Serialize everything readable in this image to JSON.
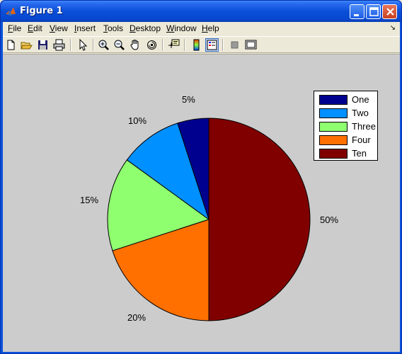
{
  "window": {
    "title": "Figure 1"
  },
  "menu": {
    "items": [
      {
        "label": "File",
        "key": "F",
        "rest": "ile"
      },
      {
        "label": "Edit",
        "key": "E",
        "rest": "dit"
      },
      {
        "label": "View",
        "key": "V",
        "rest": "iew"
      },
      {
        "label": "Insert",
        "key": "I",
        "rest": "nsert"
      },
      {
        "label": "Tools",
        "key": "T",
        "rest": "ools"
      },
      {
        "label": "Desktop",
        "key": "D",
        "rest": "esktop"
      },
      {
        "label": "Window",
        "key": "W",
        "rest": "indow"
      },
      {
        "label": "Help",
        "key": "H",
        "rest": "elp"
      }
    ],
    "arrow": "↘"
  },
  "toolbar": {
    "buttons": [
      "new-figure-icon",
      "open-file-icon",
      "save-figure-icon",
      "print-figure-icon",
      "edit-plot-arrow-icon",
      "zoom-in-icon",
      "zoom-out-icon",
      "pan-hand-icon",
      "rotate-3d-icon",
      "data-cursor-icon",
      "colorbar-icon",
      "legend-icon",
      "hide-plot-tools-icon",
      "show-plot-tools-icon"
    ]
  },
  "chart_data": {
    "type": "pie",
    "categories": [
      "One",
      "Two",
      "Three",
      "Four",
      "Ten"
    ],
    "values": [
      5,
      10,
      15,
      20,
      50
    ],
    "labels": [
      "5%",
      "10%",
      "15%",
      "20%",
      "50%"
    ],
    "colors": [
      "#00008f",
      "#0090ff",
      "#8fff70",
      "#ff7000",
      "#800000"
    ],
    "legend_position": "top-right",
    "start": "top",
    "direction": "counterclockwise"
  }
}
